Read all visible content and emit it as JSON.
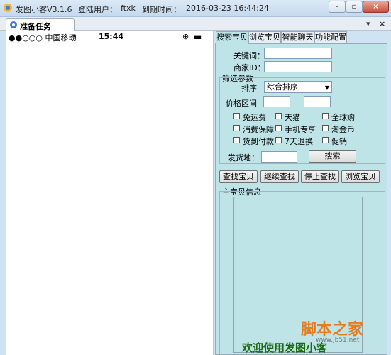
{
  "window": {
    "app_name": "发图小客V3.1.6",
    "login_label": "登陆用户：",
    "user": "ftxk",
    "expire_label": "到期时间：",
    "expire_time": "2016-03-23 16:44:24",
    "min_glyph": "–",
    "max_glyph": "▫",
    "close_glyph": "×"
  },
  "doc_tab": {
    "label": "准备任务",
    "menu_glyph": "▾",
    "close_glyph": "×"
  },
  "phone": {
    "carrier": "●●○○○ 中国移动",
    "time": "15:44",
    "wifi_glyph": "≋",
    "battery_glyph": "▬"
  },
  "tabs": [
    "搜索宝贝",
    "浏览宝贝",
    "智能聊天",
    "功能配置"
  ],
  "search": {
    "keyword_label": "关键词：",
    "merchant_label": "商家ID：",
    "filter_group_label": "筛选参数",
    "sort_label": "排序",
    "sort_value": "综合排序",
    "price_label": "价格区间",
    "checkboxes": [
      "免运费",
      "天猫",
      "全球购",
      "消费保障",
      "手机专享",
      "淘金币",
      "货到付款",
      "7天退换",
      "促销"
    ],
    "ship_from_label": "发货地：",
    "search_button": "搜索"
  },
  "actions": [
    "查找宝贝",
    "继续查找",
    "停止查找",
    "浏览宝贝"
  ],
  "info_group_label": "主宝贝信息",
  "welcome": "欢迎使用发图小客",
  "watermark": {
    "logo": "脚本之家",
    "url": "www.jb51.net"
  },
  "colors": {
    "panel_bg": "#bfe4e8",
    "title_bar": "#c5d9ee",
    "welcome_text": "#1a6b10"
  }
}
